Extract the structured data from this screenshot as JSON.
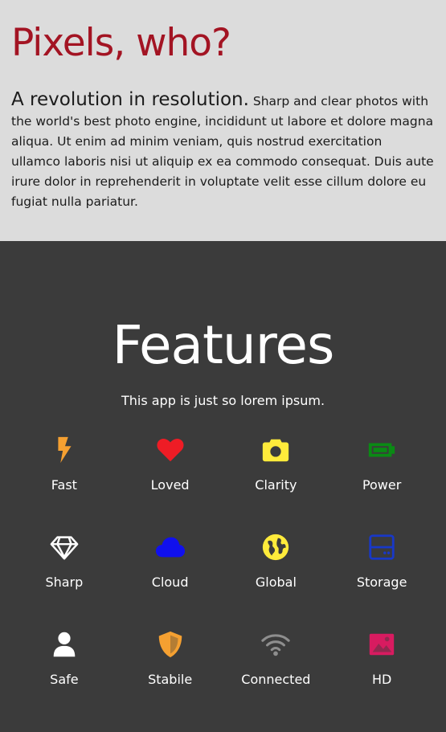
{
  "hero": {
    "title": "Pixels, who?",
    "lead": "A revolution in resolution.",
    "body": "Sharp and clear photos with the world's best photo engine, incididunt ut labore et dolore magna aliqua. Ut enim ad minim veniam, quis nostrud exercitation ullamco laboris nisi ut aliquip ex ea commodo consequat. Duis aute irure dolor in reprehenderit in voluptate velit esse cillum dolore eu fugiat nulla pariatur.",
    "title_color": "#a31423",
    "background": "#dcdcdc"
  },
  "features": {
    "title": "Features",
    "subtitle": "This app is just so lorem ipsum.",
    "background": "#3b3b3b",
    "items": [
      {
        "label": "Fast",
        "icon": "bolt-icon",
        "color": "#f5a031"
      },
      {
        "label": "Loved",
        "icon": "heart-icon",
        "color": "#ee1c25"
      },
      {
        "label": "Clarity",
        "icon": "camera-icon",
        "color": "#ffeb3b"
      },
      {
        "label": "Power",
        "icon": "battery-icon",
        "color": "#0a8a14"
      },
      {
        "label": "Sharp",
        "icon": "diamond-icon",
        "color": "#ffffff"
      },
      {
        "label": "Cloud",
        "icon": "cloud-icon",
        "color": "#1010ee"
      },
      {
        "label": "Global",
        "icon": "globe-icon",
        "color": "#ffeb3b"
      },
      {
        "label": "Storage",
        "icon": "hard-drive-icon",
        "color": "#1838c8"
      },
      {
        "label": "Safe",
        "icon": "user-icon",
        "color": "#ffffff"
      },
      {
        "label": "Stabile",
        "icon": "shield-icon",
        "color": "#f5a031"
      },
      {
        "label": "Connected",
        "icon": "wifi-icon",
        "color": "#8e8e8e"
      },
      {
        "label": "HD",
        "icon": "image-icon",
        "color": "#d81b60"
      }
    ]
  }
}
